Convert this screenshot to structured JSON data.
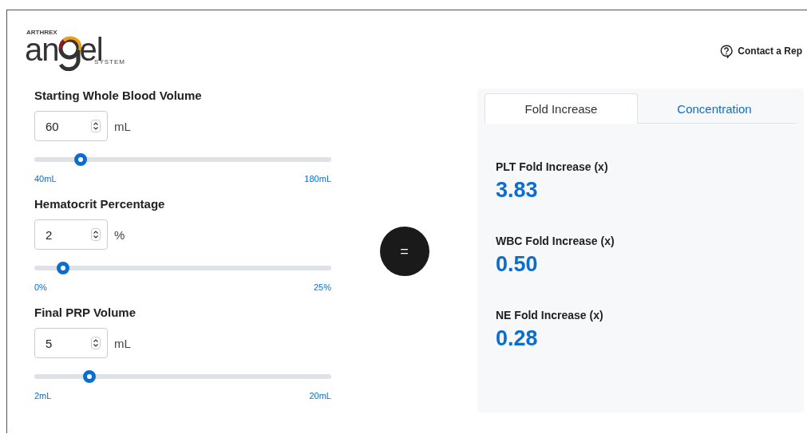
{
  "logo": {
    "top": "ARTHREX",
    "left": "an",
    "right": "el",
    "bottom": "SYSTEM"
  },
  "contact": {
    "label": "Contact a Rep"
  },
  "inputs": [
    {
      "label": "Starting Whole Blood Volume",
      "value": "60",
      "unit": "mL",
      "level": 0.14,
      "min": "40mL",
      "max": "180mL"
    },
    {
      "label": "Hematocrit Percentage",
      "value": "2",
      "unit": "%",
      "level": 0.08,
      "min": "0%",
      "max": "25%"
    },
    {
      "label": "Final PRP Volume",
      "value": "5",
      "unit": "mL",
      "level": 0.17,
      "min": "2mL",
      "max": "20mL"
    }
  ],
  "equals": "=",
  "tabs": [
    {
      "label": "Fold Increase",
      "selected": true
    },
    {
      "label": "Concentration",
      "selected": false
    }
  ],
  "results": [
    {
      "label": "PLT Fold Increase (x)",
      "value": "3.83"
    },
    {
      "label": "WBC Fold Increase (x)",
      "value": "0.50"
    },
    {
      "label": "NE Fold Increase (x)",
      "value": "0.28"
    }
  ]
}
